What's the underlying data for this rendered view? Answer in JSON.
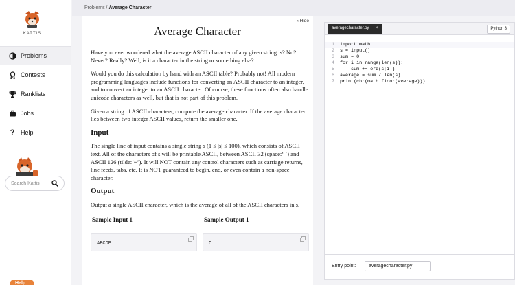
{
  "app": {
    "logo_text": "KATTIS"
  },
  "sidebar": {
    "items": [
      {
        "label": "Problems",
        "icon": "problems-icon",
        "active": true
      },
      {
        "label": "Contests",
        "icon": "contests-icon",
        "active": false
      },
      {
        "label": "Ranklists",
        "icon": "trophy-icon",
        "active": false
      },
      {
        "label": "Jobs",
        "icon": "briefcase-icon",
        "active": false
      },
      {
        "label": "Help",
        "icon": "question-icon",
        "active": false
      }
    ],
    "search_placeholder": "Search Kattis",
    "help_chip": "Help"
  },
  "breadcrumb": {
    "root": "Problems",
    "separator": "/",
    "current": "Average Character"
  },
  "problem": {
    "hide_label": "Hide",
    "title": "Average Character",
    "intro1": "Have you ever wondered what the average ASCII character of any given string is? No? Never? Really? Well, is it a character in the string or something else?",
    "intro2": "Would you do this calculation by hand with an ASCII table? Probably not! All modern programming languages include functions for converting an ASCII character to an integer, and to convert an integer to an ASCII character. Of course, these functions often also handle unicode characters as well, but that is not part of this problem.",
    "intro3": "Given a string of ASCII characters, compute the average character. If the average character lies between two integer ASCII values, return the smaller one.",
    "input_heading": "Input",
    "input_text": "The single line of input contains a single string s (1 ≤ |s| ≤ 100), which consists of ASCII text. All of the characters of s will be printable ASCII, between ASCII 32 (space:‘ ’) and ASCII 126 (tilde:‘~’). It will NOT contain any control characters such as carriage returns, line feeds, tabs, etc. It is NOT guaranteed to begin, end, or even contain a non-space character.",
    "output_heading": "Output",
    "output_text": "Output a single ASCII character, which is the average of all of the ASCII characters in s.",
    "sample_input_heading": "Sample Input 1",
    "sample_output_heading": "Sample Output 1",
    "sample_input": "ABCDE",
    "sample_output": "C"
  },
  "editor": {
    "file_tab": "averagecharacter.py",
    "close_glyph": "×",
    "language": "Python 3",
    "lines": [
      {
        "n": "1",
        "text": "import math"
      },
      {
        "n": "2",
        "text": "s = input()"
      },
      {
        "n": "3",
        "text": "sum = 0"
      },
      {
        "n": "4",
        "text": "for i in range(len(s)):"
      },
      {
        "n": "5",
        "text": "    sum += ord(s[i])"
      },
      {
        "n": "6",
        "text": "average = sum / len(s)"
      },
      {
        "n": "7",
        "text": "print(chr(math.floor(average)))"
      }
    ],
    "entry_label": "Entry point:",
    "entry_value": "averagecharacter.py"
  },
  "colors": {
    "accent": "#e8833a",
    "code_keyword": "#1a3ca8",
    "code_function": "#6a3ac8"
  }
}
